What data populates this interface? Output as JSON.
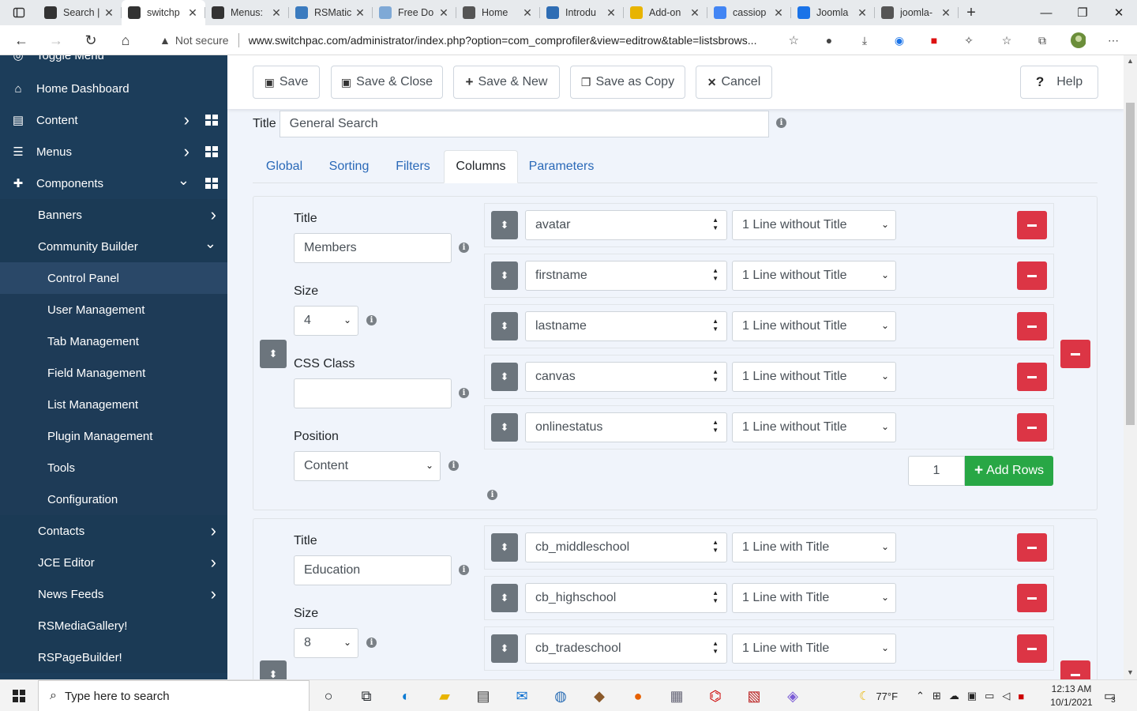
{
  "browser": {
    "tabs": [
      {
        "label": "Search |",
        "icon": "joomla-icon",
        "color": "#333333"
      },
      {
        "label": "switchp",
        "icon": "joomla-icon",
        "color": "#333333",
        "active": true
      },
      {
        "label": "Menus:",
        "icon": "joomla-icon",
        "color": "#333333"
      },
      {
        "label": "RSMatic",
        "icon": "rs-icon",
        "color": "#3b7bbf"
      },
      {
        "label": "Free Do",
        "icon": "rs-icon",
        "color": "#7fa9d6"
      },
      {
        "label": "Home",
        "icon": "document-icon",
        "color": "#555555"
      },
      {
        "label": "Introdu",
        "icon": "rs-icon",
        "color": "#2e6db4"
      },
      {
        "label": "Add-on",
        "icon": "addon-icon",
        "color": "#e8b400"
      },
      {
        "label": "cassiop",
        "icon": "google-icon",
        "color": "#4285f4"
      },
      {
        "label": "Joomla",
        "icon": "joomla-blue-icon",
        "color": "#1a73e8"
      },
      {
        "label": "joomla-",
        "icon": "document-icon",
        "color": "#555555"
      }
    ],
    "new_tab": "+",
    "security": "Not secure",
    "url": "www.switchpac.com/administrator/index.php?option=com_comprofiler&view=editrow&table=listsbrows..."
  },
  "sidebar": {
    "toggle_label": "Toggle Menu",
    "items": [
      {
        "label": "Home Dashboard",
        "icon": "home-icon",
        "level": 0
      },
      {
        "label": "Content",
        "icon": "file-icon",
        "level": 0,
        "chevron": "right",
        "dashboard": true
      },
      {
        "label": "Menus",
        "icon": "list-icon",
        "level": 0,
        "chevron": "right",
        "dashboard": true
      },
      {
        "label": "Components",
        "icon": "puzzle-icon",
        "level": 0,
        "chevron": "down",
        "dashboard": true
      },
      {
        "label": "Banners",
        "level": 1,
        "chevron": "right"
      },
      {
        "label": "Community Builder",
        "level": 1,
        "chevron": "down"
      },
      {
        "label": "Control Panel",
        "level": 2,
        "active": true
      },
      {
        "label": "User Management",
        "level": 2
      },
      {
        "label": "Tab Management",
        "level": 2
      },
      {
        "label": "Field Management",
        "level": 2
      },
      {
        "label": "List Management",
        "level": 2
      },
      {
        "label": "Plugin Management",
        "level": 2
      },
      {
        "label": "Tools",
        "level": 2
      },
      {
        "label": "Configuration",
        "level": 2
      },
      {
        "label": "Contacts",
        "level": 1,
        "chevron": "right"
      },
      {
        "label": "JCE Editor",
        "level": 1,
        "chevron": "right"
      },
      {
        "label": "News Feeds",
        "level": 1,
        "chevron": "right"
      },
      {
        "label": "RSMediaGallery!",
        "level": 1
      },
      {
        "label": "RSPageBuilder!",
        "level": 1
      }
    ]
  },
  "toolbar": {
    "save": "Save",
    "save_close": "Save & Close",
    "save_new": "Save & New",
    "save_copy": "Save as Copy",
    "cancel": "Cancel",
    "help_q": "?",
    "help": "Help"
  },
  "form": {
    "title_label": "Title",
    "title_value": "General Search"
  },
  "tabs": [
    "Global",
    "Sorting",
    "Filters",
    "Columns",
    "Parameters"
  ],
  "panels": [
    {
      "title_label": "Title",
      "title_value": "Members",
      "size_label": "Size",
      "size_value": "4",
      "css_label": "CSS Class",
      "css_value": "",
      "position_label": "Position",
      "position_value": "Content",
      "rows": [
        {
          "field": "avatar",
          "display": "1 Line without Title"
        },
        {
          "field": "firstname",
          "display": "1 Line without Title"
        },
        {
          "field": "lastname",
          "display": "1 Line without Title"
        },
        {
          "field": "canvas",
          "display": "1 Line without Title"
        },
        {
          "field": "onlinestatus",
          "display": "1 Line without Title"
        }
      ],
      "add_rows_count": "1",
      "add_rows_label": "Add Rows"
    },
    {
      "title_label": "Title",
      "title_value": "Education",
      "size_label": "Size",
      "size_value": "8",
      "rows": [
        {
          "field": "cb_middleschool",
          "display": "1 Line with Title"
        },
        {
          "field": "cb_highschool",
          "display": "1 Line with Title"
        },
        {
          "field": "cb_tradeschool",
          "display": "1 Line with Title"
        }
      ]
    }
  ],
  "taskbar": {
    "search_placeholder": "Type here to search",
    "weather": "77°F",
    "time": "12:13 AM",
    "date": "10/1/2021",
    "notifications": "3"
  },
  "colors": {
    "sidebar": "#1c3d5a",
    "danger": "#dc3545",
    "success": "#28a745",
    "link": "#2a69b8",
    "handle": "#6c757d"
  }
}
